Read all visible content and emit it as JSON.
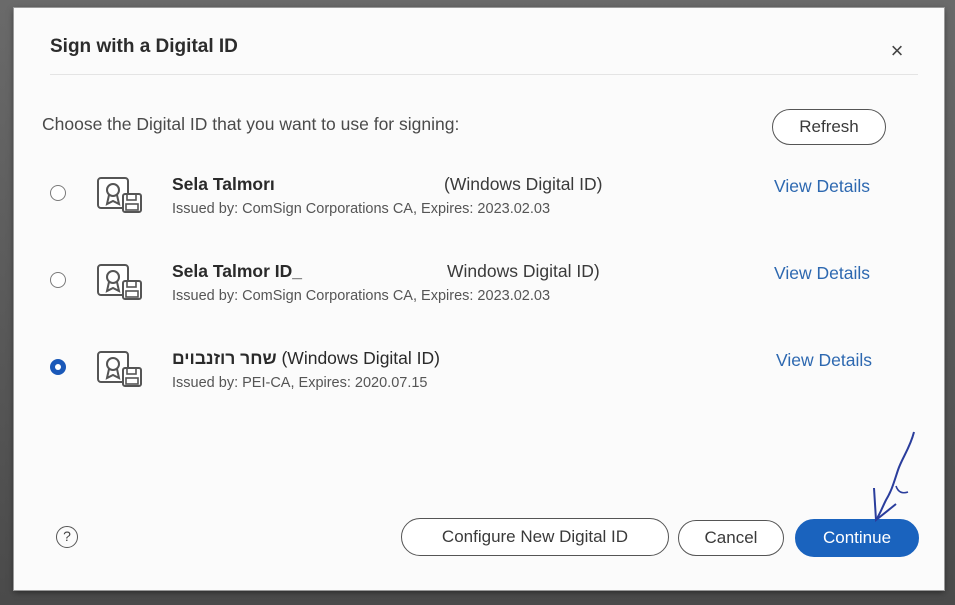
{
  "dialog": {
    "title": "Sign with a Digital ID",
    "close_glyph": "×",
    "prompt": "Choose the Digital ID that you want to use for signing:",
    "refresh_label": "Refresh"
  },
  "ids": [
    {
      "name": "Sela Talmorı",
      "type": "(Windows Digital ID)",
      "issuer": "Issued by: ComSign Corporations CA, Expires: 2023.02.03",
      "view_label": "View Details",
      "selected": false
    },
    {
      "name": "Sela Talmor ID_",
      "type": "Windows Digital ID)",
      "issuer": "Issued by: ComSign Corporations CA, Expires: 2023.02.03",
      "view_label": "View Details",
      "selected": false
    },
    {
      "name": "שחר רוזנבוים",
      "type": "(Windows Digital ID)",
      "issuer": "Issued by: PEI-CA, Expires: 2020.07.15",
      "view_label": "View Details",
      "selected": true
    }
  ],
  "footer": {
    "help_glyph": "?",
    "configure_label": "Configure New Digital ID",
    "cancel_label": "Cancel",
    "continue_label": "Continue"
  },
  "colors": {
    "accent": "#1a63be",
    "link": "#2d68b0",
    "annotation_ink": "#2a3d9c"
  },
  "icons": {
    "id_icon": "digital-id-certificate-icon",
    "close": "close-icon",
    "help": "help-icon"
  }
}
